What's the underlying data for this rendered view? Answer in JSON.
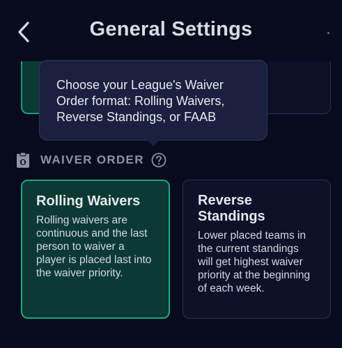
{
  "header": {
    "title": "General Settings"
  },
  "tooltip": {
    "text": "Choose your League's Waiver Order format: Rolling Waivers, Reverse Standings, or FAAB"
  },
  "section": {
    "label": "WAIVER ORDER"
  },
  "options": [
    {
      "title": "Rolling Waivers",
      "description": "Rolling waivers are continuous and the last person to waiver a player is placed last into the waiver priority.",
      "selected": true
    },
    {
      "title": "Reverse Standings",
      "description": "Lower placed teams in the current standings will get highest waiver priority at the beginning of each week.",
      "selected": false
    }
  ],
  "colors": {
    "background": "#080b1e",
    "selected_border": "#22a581",
    "selected_fill": "#0b3a34",
    "tooltip_fill": "#1a2040"
  },
  "icons": {
    "back": "chevron-left-icon",
    "section": "clipboard-icon",
    "help": "question-circle-icon"
  }
}
